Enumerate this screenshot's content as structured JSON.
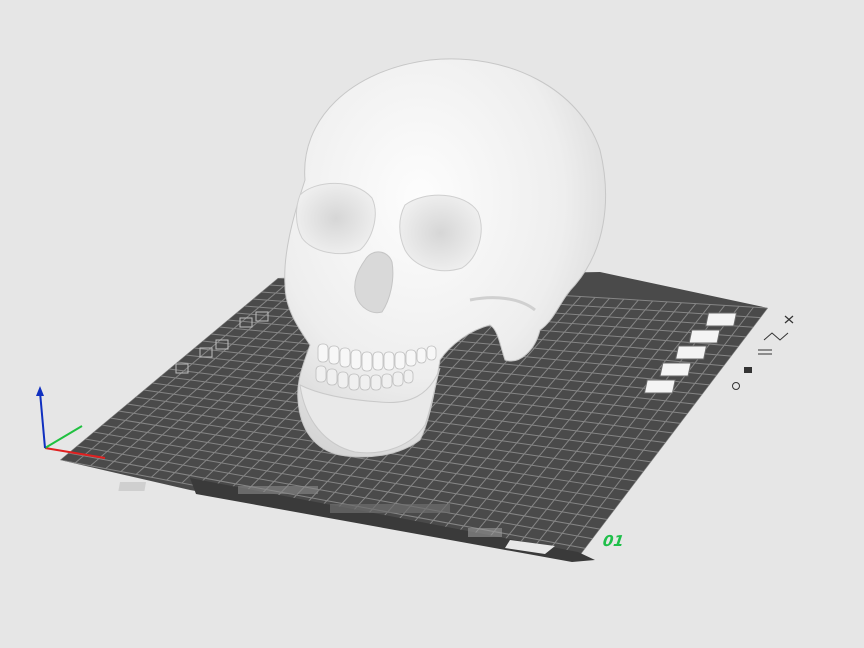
{
  "viewport": {
    "background": "#e6e6e6",
    "plate_number": "01",
    "plate_number_color": "#1fbf4a",
    "bed_color": "#4a4a4a",
    "grid_color": "#9a9a9a",
    "model": "skull",
    "axes": {
      "x_color": "#e02020",
      "y_color": "#20c040",
      "z_color": "#1030c0"
    }
  },
  "plate_toolbar": [
    {
      "name": "close-plate-button",
      "icon": "close-icon"
    },
    {
      "name": "arrange-plate-button",
      "icon": "arrange-icon"
    },
    {
      "name": "orient-plate-button",
      "icon": "orient-icon"
    },
    {
      "name": "lock-plate-button",
      "icon": "lock-icon"
    },
    {
      "name": "plate-settings-button",
      "icon": "gear-icon"
    }
  ]
}
